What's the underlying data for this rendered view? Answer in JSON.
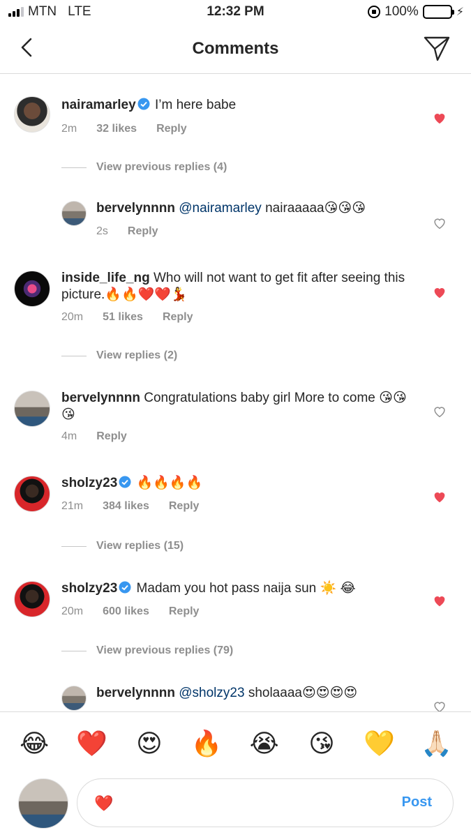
{
  "status": {
    "carrier": "MTN",
    "network": "LTE",
    "time": "12:32 PM",
    "battery": "100%",
    "battery_level": 1.0
  },
  "nav": {
    "title": "Comments",
    "back_icon": "chevron-left-icon",
    "send_icon": "paper-plane-icon"
  },
  "comments": [
    {
      "username": "nairamarley",
      "verified": true,
      "text": "I’m here babe",
      "time": "2m",
      "likes": "32 likes",
      "reply": "Reply",
      "liked": true,
      "view_replies": "View previous replies (4)"
    },
    {
      "username": "bervelynnnn",
      "mention": "@nairamarley",
      "text": "nairaaaaa😘😘😘",
      "time": "2s",
      "reply": "Reply",
      "liked": false,
      "is_reply": true
    },
    {
      "username": "inside_life_ng",
      "text": "Who will not want to get fit after seeing this picture.🔥🔥❤️❤️💃",
      "time": "20m",
      "likes": "51 likes",
      "reply": "Reply",
      "liked": true,
      "view_replies": "View replies (2)"
    },
    {
      "username": "bervelynnnn",
      "text": "Congratulations baby girl  More to come 😘😘😘",
      "time": "4m",
      "reply": "Reply",
      "liked": false
    },
    {
      "username": "sholzy23",
      "verified": true,
      "text": "🔥🔥🔥🔥",
      "time": "21m",
      "likes": "384 likes",
      "reply": "Reply",
      "liked": true,
      "view_replies": "View replies (15)"
    },
    {
      "username": "sholzy23",
      "verified": true,
      "text": "Madam you hot pass naija sun ☀️ 😂",
      "time": "20m",
      "likes": "600 likes",
      "reply": "Reply",
      "liked": true,
      "view_replies": "View previous replies (79)"
    },
    {
      "username": "bervelynnnn",
      "mention": "@sholzy23",
      "text": "sholaaaa😍😍😍😍",
      "liked": false,
      "is_reply": true
    }
  ],
  "emoji_bar": [
    "😂",
    "❤️",
    "😍",
    "🔥",
    "😭",
    "😘",
    "💛",
    "🙏🏻"
  ],
  "input": {
    "value": "❤️",
    "post_label": "Post"
  },
  "colors": {
    "liked_heart": "#ed4956",
    "mention": "#003569",
    "post": "#3897f0",
    "meta": "#8e8e8e"
  }
}
